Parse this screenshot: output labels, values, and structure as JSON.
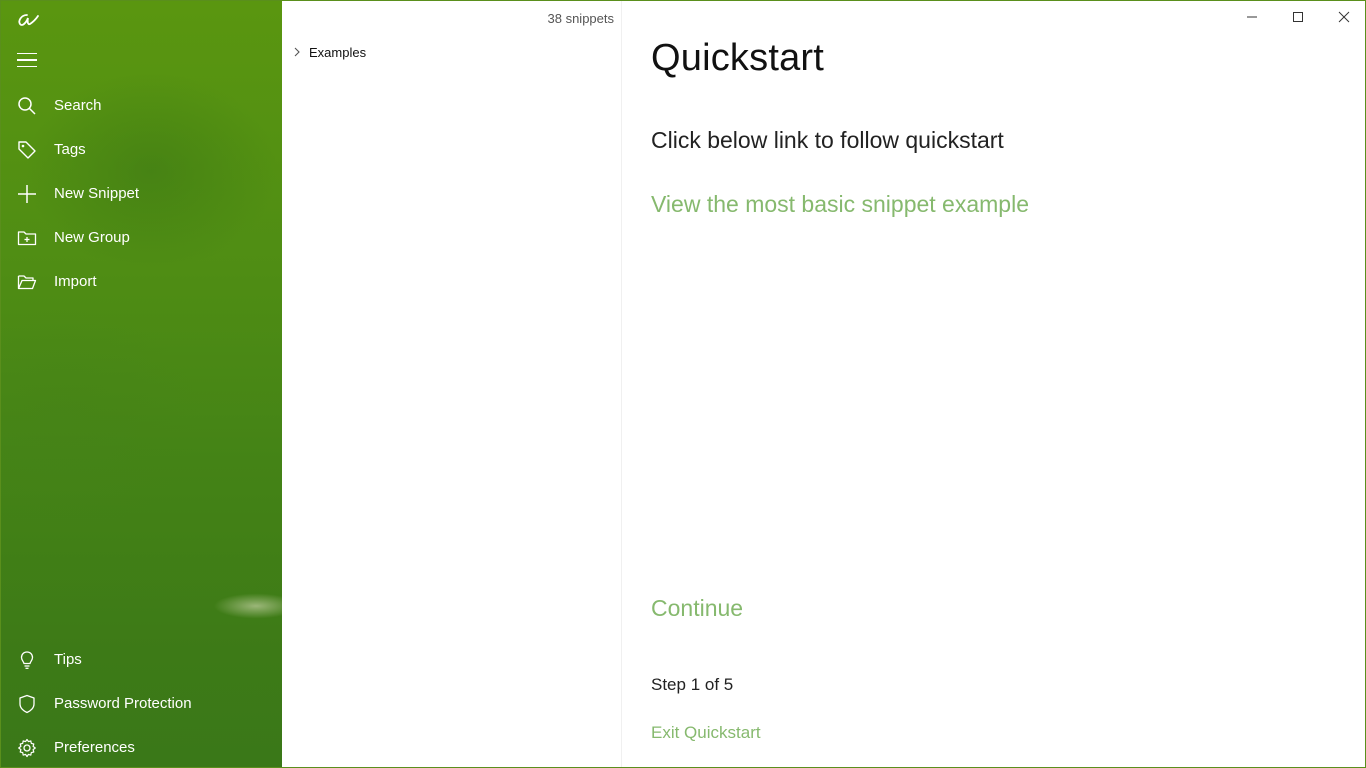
{
  "sidebar": {
    "logo_icon": "script-a-logo",
    "menu_icon": "hamburger-icon",
    "top_items": [
      {
        "label": "Search",
        "icon": "search-icon"
      },
      {
        "label": "Tags",
        "icon": "tag-icon"
      },
      {
        "label": "New Snippet",
        "icon": "plus-icon"
      },
      {
        "label": "New Group",
        "icon": "folder-plus-icon"
      },
      {
        "label": "Import",
        "icon": "folder-open-icon"
      }
    ],
    "bottom_items": [
      {
        "label": "Tips",
        "icon": "lightbulb-icon"
      },
      {
        "label": "Password Protection",
        "icon": "shield-icon"
      },
      {
        "label": "Preferences",
        "icon": "gear-icon"
      }
    ]
  },
  "list": {
    "count_label": "38 snippets",
    "groups": [
      {
        "label": "Examples",
        "expanded": false
      }
    ]
  },
  "content": {
    "title": "Quickstart",
    "subtitle": "Click below link to follow quickstart",
    "basic_link": "View the most basic snippet example",
    "continue_label": "Continue",
    "step_label": "Step 1 of 5",
    "exit_label": "Exit Quickstart"
  },
  "window_controls": {
    "minimize_icon": "minimize-icon",
    "maximize_icon": "maximize-icon",
    "close_icon": "close-icon"
  },
  "colors": {
    "sidebar_green": "#4f8d14",
    "accent_link": "#86b96e",
    "border": "#5a8f1c"
  }
}
